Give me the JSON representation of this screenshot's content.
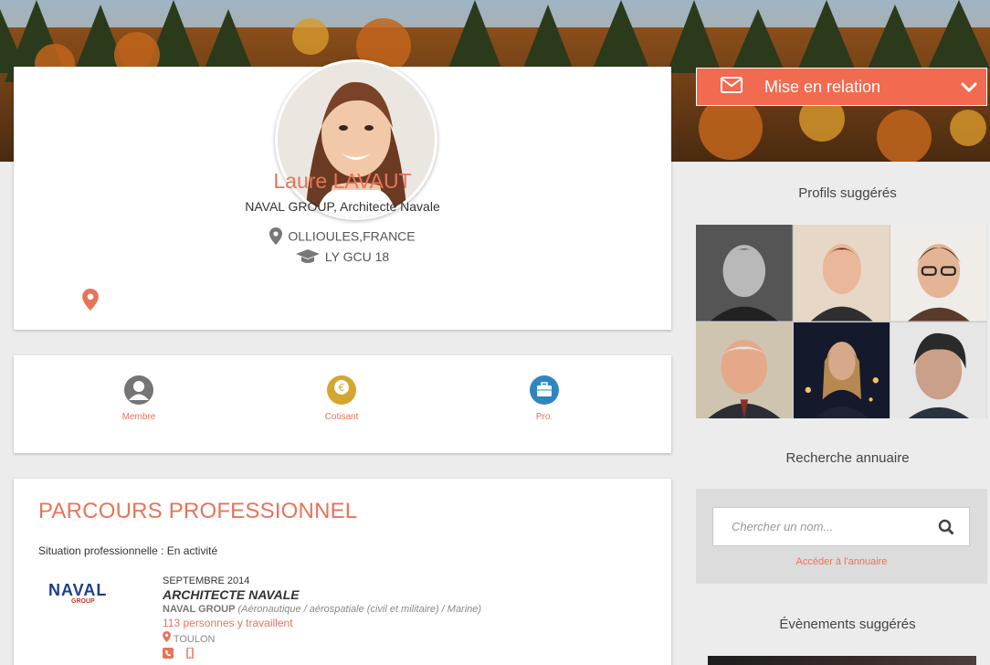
{
  "profile": {
    "name": "Laure LAVAUT",
    "subtitle": "NAVAL GROUP, Architecte Navale",
    "location": "OLLIOULES,FRANCE",
    "education": "LY GCU 18"
  },
  "statuses": [
    {
      "label": "Membre",
      "icon": "user-icon",
      "color": "#757575"
    },
    {
      "label": "Cotisant",
      "icon": "euro-icon",
      "color": "#d4a630"
    },
    {
      "label": "Pro.",
      "icon": "briefcase-icon",
      "color": "#2e86c1"
    }
  ],
  "career": {
    "title": "PARCOURS PROFESSIONNEL",
    "situation": "Situation professionnelle : En activité",
    "logo_line1": "NAVAL",
    "logo_line2": "GROUP",
    "job": {
      "date": "SEPTEMBRE 2014",
      "title": "ARCHITECTE NAVALE",
      "company": "NAVAL GROUP",
      "sector": "(Aéronautique / aérospatiale (civil et militaire) / Marine)",
      "people": "113 personnes y travaillent",
      "city": "TOULON"
    }
  },
  "sidebar": {
    "relation_label": "Mise en relation",
    "suggested_profiles_title": "Profils suggérés",
    "directory_title": "Recherche annuaire",
    "search_placeholder": "Chercher un nom...",
    "directory_link": "Accéder à l'annuaire",
    "events_title": "Évènements suggérés"
  },
  "colors": {
    "accent": "#e8735a",
    "button": "#f26a4f"
  }
}
